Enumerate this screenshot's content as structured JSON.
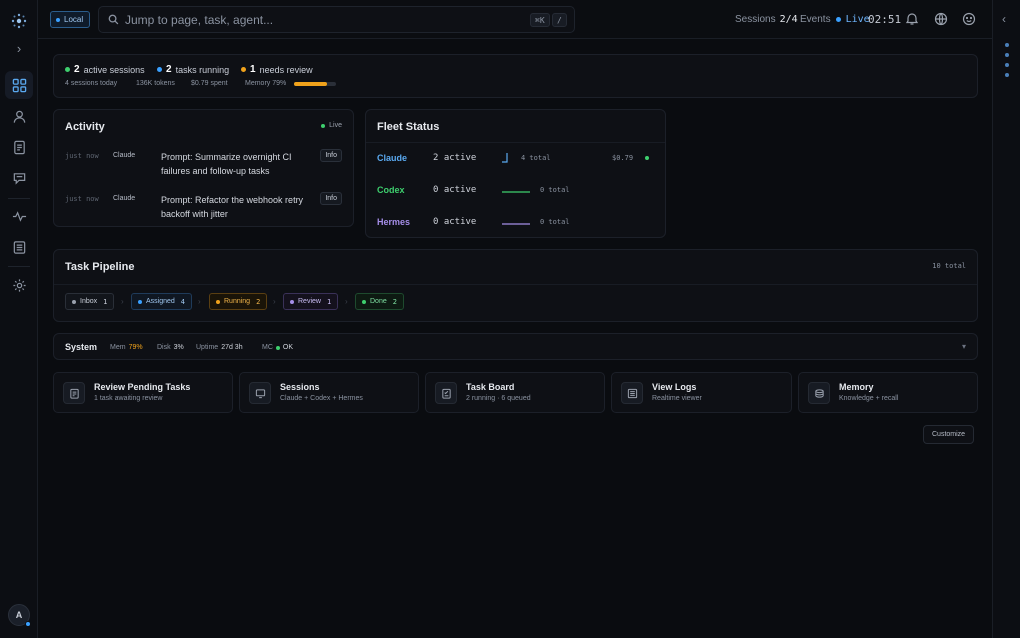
{
  "topbar": {
    "env_badge": "Local",
    "search_placeholder": "Jump to page, task, agent...",
    "kbd_cmd": "⌘K",
    "kbd_slash": "/",
    "sessions_label": "Sessions",
    "sessions_value": "2/4",
    "events_label": "Events",
    "events_status": "Live",
    "clock": "02:51",
    "icons": [
      "notification-icon",
      "globe-icon",
      "smiley-icon"
    ]
  },
  "summary": {
    "active_sessions_count": "2",
    "active_sessions_label": "active sessions",
    "tasks_running_count": "2",
    "tasks_running_label": "tasks running",
    "needs_review_count": "1",
    "needs_review_label": "needs review",
    "sessions_today": "4 sessions today",
    "tokens": "136K tokens",
    "spent": "$0.79 spent",
    "memory": "Memory 79%",
    "memory_pct": 79,
    "colors": {
      "active": "#3ecf6e",
      "running": "#3aa0ff",
      "review": "#f0a21b"
    }
  },
  "activity": {
    "title": "Activity",
    "live_label": "Live",
    "rows": [
      {
        "time": "just now",
        "agent": "Claude",
        "text": "Prompt: Summarize overnight CI failures and follow-up tasks",
        "badge": "Info"
      },
      {
        "time": "just now",
        "agent": "Claude",
        "text": "Prompt: Refactor the webhook retry backoff with jitter",
        "badge": "Info"
      }
    ]
  },
  "fleet": {
    "title": "Fleet Status",
    "agents": [
      {
        "name": "Claude",
        "active": "2 active",
        "total": "4 total",
        "cost": "$0.79",
        "color": "#5aa9f0",
        "spark": "#5aa9f0"
      },
      {
        "name": "Codex",
        "active": "0 active",
        "total": "0 total",
        "cost": "",
        "color": "#3ecf6e",
        "spark": "#3ecf6e"
      },
      {
        "name": "Hermes",
        "active": "0 active",
        "total": "0 total",
        "cost": "",
        "color": "#a58ee8",
        "spark": "#a58ee8"
      }
    ]
  },
  "pipeline": {
    "title": "Task Pipeline",
    "total": "10 total",
    "stages": [
      {
        "label": "Inbox",
        "count": "1",
        "color": "#9aa1ad",
        "border": "#2a2f38",
        "bg": "#12151b",
        "text": "#c9ced8"
      },
      {
        "label": "Assigned",
        "count": "4",
        "color": "#3aa0ff",
        "border": "#1f3b5a",
        "bg": "#0f1722",
        "text": "#9fc6ee"
      },
      {
        "label": "Running",
        "count": "2",
        "color": "#f0a21b",
        "border": "#5a3f12",
        "bg": "#1a1408",
        "text": "#f0b44a"
      },
      {
        "label": "Review",
        "count": "1",
        "color": "#a58ee8",
        "border": "#3a3158",
        "bg": "#14111d",
        "text": "#c8bcf2"
      },
      {
        "label": "Done",
        "count": "2",
        "color": "#3ecf6e",
        "border": "#1e4a2e",
        "bg": "#0d1a12",
        "text": "#7fe0a2"
      }
    ]
  },
  "system": {
    "title": "System",
    "mem_label": "Mem",
    "mem_value": "79%",
    "disk_label": "Disk",
    "disk_value": "3%",
    "uptime_label": "Uptime",
    "uptime_value": "27d 3h",
    "mc_label": "MC",
    "mc_value": "OK",
    "expand_glyph": "▾"
  },
  "quick": [
    {
      "title": "Review Pending Tasks",
      "sub": "1 task awaiting review",
      "icon": "clipboard-icon"
    },
    {
      "title": "Sessions",
      "sub": "Claude + Codex + Hermes",
      "icon": "monitor-icon"
    },
    {
      "title": "Task Board",
      "sub": "2 running · 6 queued",
      "icon": "checklist-icon"
    },
    {
      "title": "View Logs",
      "sub": "Realtime viewer",
      "icon": "log-icon"
    },
    {
      "title": "Memory",
      "sub": "Knowledge + recall",
      "icon": "database-icon"
    }
  ],
  "customize_label": "Customize",
  "user": {
    "avatar_initial": "A"
  }
}
